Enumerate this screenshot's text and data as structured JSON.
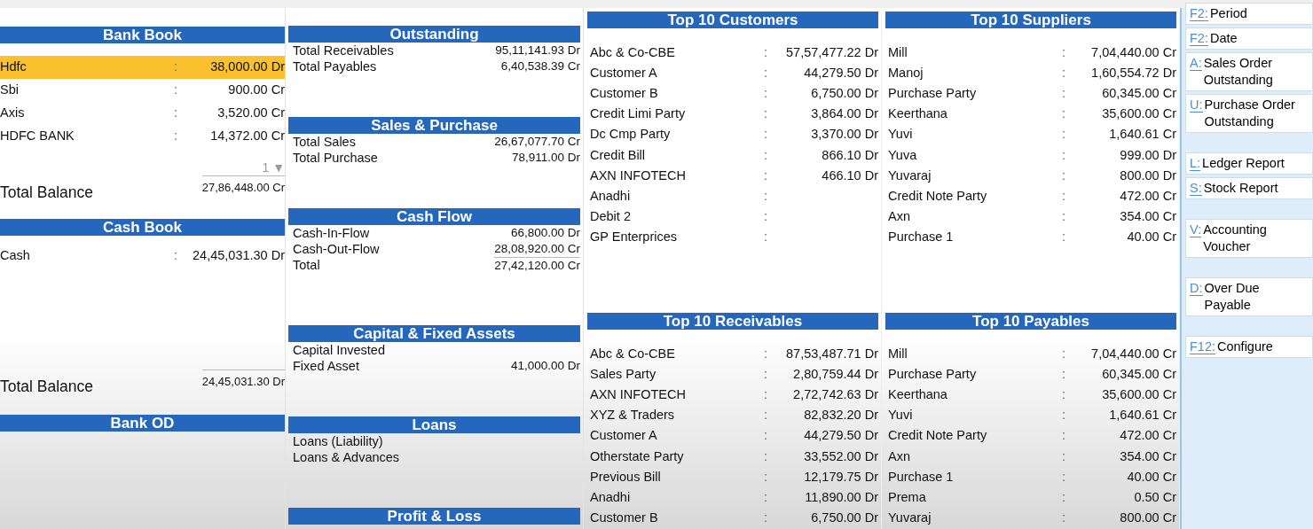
{
  "bank_book": {
    "title": "Bank Book",
    "rows": [
      {
        "name": "Hdfc",
        "colon": ":",
        "amount": "38,000.00 Dr",
        "selected": true
      },
      {
        "name": "Sbi",
        "colon": ":",
        "amount": "900.00 Cr",
        "selected": false
      },
      {
        "name": "Axis",
        "colon": ":",
        "amount": "3,520.00 Cr",
        "selected": false
      },
      {
        "name": "HDFC  BANK",
        "colon": ":",
        "amount": "14,372.00 Cr",
        "selected": false
      }
    ],
    "page": "1",
    "page_arrow": "▼",
    "total": {
      "label": "Total Balance",
      "amount": "27,86,448.00 Cr"
    }
  },
  "cash_book": {
    "title": "Cash Book",
    "rows": [
      {
        "name": "Cash",
        "colon": ":",
        "amount": "24,45,031.30 Dr",
        "selected": false
      }
    ],
    "total": {
      "label": "Total Balance",
      "amount": "24,45,031.30 Dr"
    }
  },
  "bank_od": {
    "title": "Bank OD"
  },
  "summary_sections": [
    {
      "title": "Outstanding",
      "rows": [
        {
          "label": "Total Receivables",
          "amount": "95,11,141.93 Dr",
          "kind": "item"
        },
        {
          "label": "Total Payables",
          "amount": "6,40,538.39 Cr",
          "kind": "item"
        }
      ]
    },
    {
      "title": "Sales & Purchase",
      "rows": [
        {
          "label": "Total Sales",
          "amount": "26,67,077.70 Cr",
          "kind": "item"
        },
        {
          "label": "Total Purchase",
          "amount": "78,911.00 Dr",
          "kind": "item"
        }
      ]
    },
    {
      "title": "Cash Flow",
      "rows": [
        {
          "label": "Cash-In-Flow",
          "amount": "66,800.00 Dr",
          "kind": "item"
        },
        {
          "label": "Cash-Out-Flow",
          "amount": "28,08,920.00 Cr",
          "kind": "item"
        },
        {
          "label": "Total",
          "amount": "27,42,120.00 Cr",
          "kind": "total"
        }
      ]
    },
    {
      "title": "Capital & Fixed Assets",
      "rows": [
        {
          "label": "Capital Invested",
          "kind": "item"
        },
        {
          "label": "Fixed Asset",
          "amount": "41,000.00 Dr",
          "kind": "item"
        }
      ]
    },
    {
      "title": "Loans",
      "rows": [
        {
          "label": "Loans (Liability)",
          "kind": "item"
        },
        {
          "label": "Loans & Advances",
          "kind": "item"
        }
      ]
    },
    {
      "title": "Profit & Loss"
    }
  ],
  "top_panels": [
    {
      "title": "Top 10 Customers",
      "rows": [
        {
          "name": "Abc & Co-CBE",
          "colon": ":",
          "amount": "57,57,477.22 Dr"
        },
        {
          "name": "Customer A",
          "colon": ":",
          "amount": "44,279.50 Dr"
        },
        {
          "name": "Customer B",
          "colon": ":",
          "amount": "6,750.00 Dr"
        },
        {
          "name": "Credit Limi Party",
          "colon": ":",
          "amount": "3,864.00 Dr"
        },
        {
          "name": "Dc Cmp Party",
          "colon": ":",
          "amount": "3,370.00 Dr"
        },
        {
          "name": "Credit Bill",
          "colon": ":",
          "amount": "866.10 Dr"
        },
        {
          "name": "AXN INFOTECH",
          "colon": ":",
          "amount": "466.10 Dr"
        },
        {
          "name": "Anadhi",
          "colon": ":"
        },
        {
          "name": "Debit 2",
          "colon": ":"
        },
        {
          "name": "GP Enterprices",
          "colon": ":"
        }
      ]
    },
    {
      "title": "Top 10 Suppliers",
      "rows": [
        {
          "name": "Mill",
          "colon": ":",
          "amount": "7,04,440.00 Cr"
        },
        {
          "name": "Manoj",
          "colon": ":",
          "amount": "1,60,554.72 Dr"
        },
        {
          "name": "Purchase Party",
          "colon": ":",
          "amount": "60,345.00 Cr"
        },
        {
          "name": "Keerthana",
          "colon": ":",
          "amount": "35,600.00 Cr"
        },
        {
          "name": "Yuvi",
          "colon": ":",
          "amount": "1,640.61 Cr"
        },
        {
          "name": "Yuva",
          "colon": ":",
          "amount": "999.00 Dr"
        },
        {
          "name": "Yuvaraj",
          "colon": ":",
          "amount": "800.00 Dr"
        },
        {
          "name": "Credit Note Party",
          "colon": ":",
          "amount": "472.00 Cr"
        },
        {
          "name": "Axn",
          "colon": ":",
          "amount": "354.00 Cr"
        },
        {
          "name": "Purchase 1",
          "colon": ":",
          "amount": "40.00 Cr"
        }
      ]
    },
    {
      "title": "Top 10 Receivables",
      "rows": [
        {
          "name": "Abc & Co-CBE",
          "colon": ":",
          "amount": "87,53,487.71 Dr"
        },
        {
          "name": "Sales Party",
          "colon": ":",
          "amount": "2,80,759.44 Dr"
        },
        {
          "name": "AXN INFOTECH",
          "colon": ":",
          "amount": "2,72,742.63 Dr"
        },
        {
          "name": "XYZ & Traders",
          "colon": ":",
          "amount": "82,832.20 Dr"
        },
        {
          "name": "Customer A",
          "colon": ":",
          "amount": "44,279.50 Dr"
        },
        {
          "name": "Otherstate Party",
          "colon": ":",
          "amount": "33,552.00 Dr"
        },
        {
          "name": "Previous Bill",
          "colon": ":",
          "amount": "12,179.75 Dr"
        },
        {
          "name": "Anadhi",
          "colon": ":",
          "amount": "11,890.00 Dr"
        },
        {
          "name": "Customer B",
          "colon": ":",
          "amount": "6,750.00 Dr"
        }
      ]
    },
    {
      "title": "Top 10 Payables",
      "rows": [
        {
          "name": "Mill",
          "colon": ":",
          "amount": "7,04,440.00 Cr"
        },
        {
          "name": "Purchase Party",
          "colon": ":",
          "amount": "60,345.00 Cr"
        },
        {
          "name": "Keerthana",
          "colon": ":",
          "amount": "35,600.00 Cr"
        },
        {
          "name": "Yuvi",
          "colon": ":",
          "amount": "1,640.61 Cr"
        },
        {
          "name": "Credit Note Party",
          "colon": ":",
          "amount": "472.00 Cr"
        },
        {
          "name": "Axn",
          "colon": ":",
          "amount": "354.00 Cr"
        },
        {
          "name": "Purchase 1",
          "colon": ":",
          "amount": "40.00 Cr"
        },
        {
          "name": "Prema",
          "colon": ":",
          "amount": "0.50 Cr"
        },
        {
          "name": "Yuvaraj",
          "colon": ":",
          "amount": "800.00 Cr"
        }
      ]
    }
  ],
  "sidebar_groups": [
    [
      {
        "key": "F2:",
        "label": "Period"
      },
      {
        "key": "F2:",
        "label": "Date"
      },
      {
        "key": "A:",
        "label": "Sales Order Outstanding"
      },
      {
        "key": "U:",
        "label": "Purchase Order Outstanding"
      }
    ],
    [
      {
        "key": "L:",
        "label": "Ledger Report"
      },
      {
        "key": "S:",
        "label": "Stock Report"
      }
    ],
    [
      {
        "key": "V:",
        "label": "Accounting Voucher"
      }
    ],
    [
      {
        "key": "D:",
        "label": "Over Due Payable"
      }
    ],
    [
      {
        "key": "F12:",
        "label": "Configure"
      }
    ]
  ]
}
